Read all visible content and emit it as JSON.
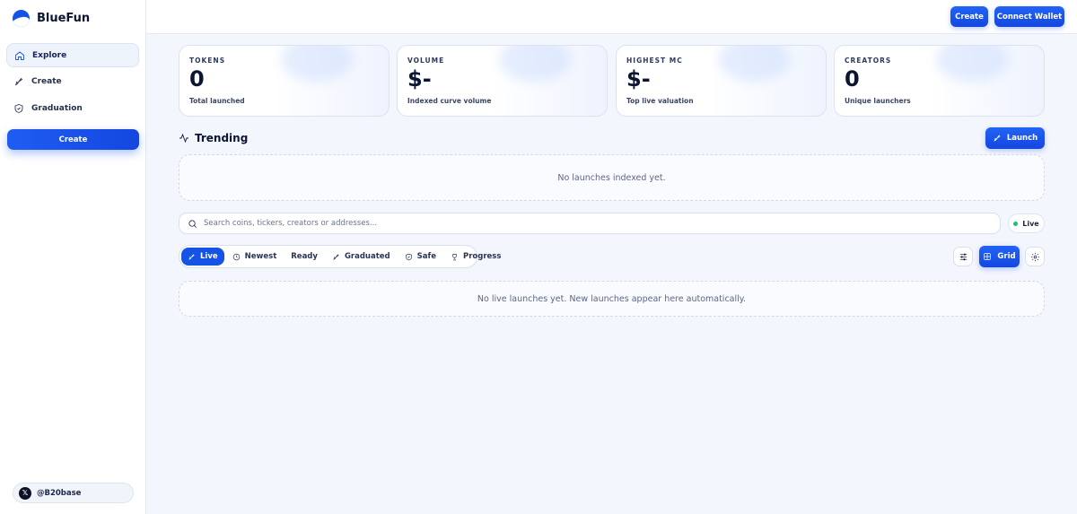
{
  "brand": {
    "name": "BlueFun"
  },
  "sidebar": {
    "items": [
      {
        "label": "Explore",
        "icon": "home-icon",
        "active": true
      },
      {
        "label": "Create",
        "icon": "rocket-icon",
        "active": false
      },
      {
        "label": "Graduation",
        "icon": "shield-icon",
        "active": false
      }
    ],
    "create_label": "Create",
    "twitter_handle": "@B20base"
  },
  "topbar": {
    "create_label": "Create",
    "connect_label": "Connect Wallet"
  },
  "stats": [
    {
      "label": "TOKENS",
      "value": "0",
      "sub": "Total launched"
    },
    {
      "label": "VOLUME",
      "value": "$-",
      "sub": "Indexed curve volume"
    },
    {
      "label": "HIGHEST MC",
      "value": "$-",
      "sub": "Top live valuation"
    },
    {
      "label": "CREATORS",
      "value": "0",
      "sub": "Unique launchers"
    }
  ],
  "trending": {
    "title": "Trending",
    "launch_label": "Launch",
    "empty": "No launches indexed yet."
  },
  "search": {
    "placeholder": "Search coins, tickers, creators or addresses...",
    "live_label": "Live"
  },
  "filters": [
    {
      "label": "Live",
      "icon": "rocket-icon",
      "active": true
    },
    {
      "label": "Newest",
      "icon": "clock-icon",
      "active": false
    },
    {
      "label": "Ready",
      "icon": "",
      "active": false
    },
    {
      "label": "Graduated",
      "icon": "rocket-icon",
      "active": false
    },
    {
      "label": "Safe",
      "icon": "shield-icon",
      "active": false
    },
    {
      "label": "Progress",
      "icon": "trophy-icon",
      "active": false
    }
  ],
  "view": {
    "grid_label": "Grid"
  },
  "feed": {
    "empty": "No live launches yet. New launches appear here automatically."
  },
  "colors": {
    "accent": "#1552e6",
    "live_dot": "#1fbf75"
  }
}
